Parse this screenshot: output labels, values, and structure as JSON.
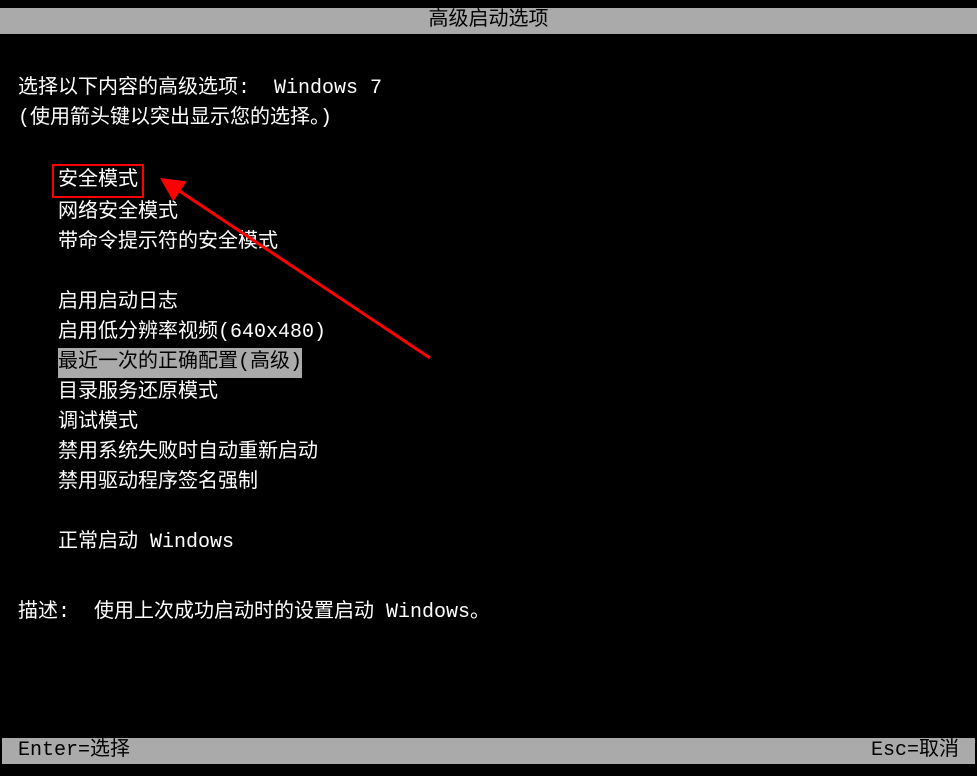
{
  "title": "高级启动选项",
  "intro": {
    "line1_prefix": "选择以下内容的高级选项:  ",
    "os_name": "Windows 7",
    "line2": "(使用箭头键以突出显示您的选择。)"
  },
  "menu": {
    "group1": [
      "安全模式",
      "网络安全模式",
      "带命令提示符的安全模式"
    ],
    "group2": [
      "启用启动日志",
      "启用低分辨率视频(640x480)",
      "最近一次的正确配置(高级)",
      "目录服务还原模式",
      "调试模式",
      "禁用系统失败时自动重新启动",
      "禁用驱动程序签名强制"
    ],
    "group3": [
      "正常启动 Windows"
    ],
    "selected_index_group2": 2,
    "boxed_index_group1": 0
  },
  "description": {
    "label": "描述:  ",
    "text": "使用上次成功启动时的设置启动 Windows。"
  },
  "footer": {
    "left": "Enter=选择",
    "right": "Esc=取消"
  },
  "annotation": {
    "type": "arrow",
    "color": "#ff0000"
  }
}
